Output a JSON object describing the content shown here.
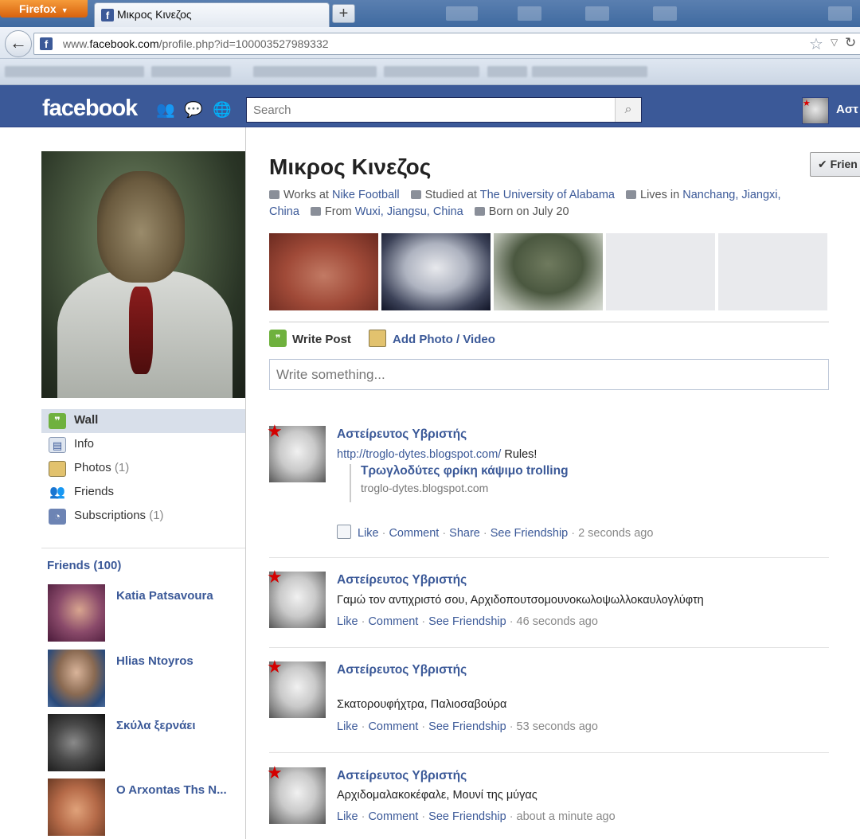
{
  "browser": {
    "app_button": "Firefox",
    "tab_title": "Μικρος Κινεζος",
    "new_tab": "+",
    "url_prefix": "www.",
    "url_domain": "facebook.com",
    "url_path": "/profile.php?id=100003527989332"
  },
  "fb": {
    "logo": "facebook",
    "search_placeholder": "Search",
    "user_short": "Αστ"
  },
  "profile": {
    "name": "Μικρος Κινεζος",
    "friend_button": "Frien",
    "works_label": "Works at",
    "works_value": "Nike Football",
    "studied_label": "Studied at",
    "studied_value": "The University of Alabama",
    "lives_label": "Lives in",
    "lives_value_1": "Nanchang, Jiangxi,",
    "lives_value_2": "China",
    "from_label": "From",
    "from_value": "Wuxi, Jiangsu, China",
    "born": "Born on July 20"
  },
  "nav": {
    "wall": "Wall",
    "info": "Info",
    "photos": "Photos",
    "photos_count": "(1)",
    "friends": "Friends",
    "subscriptions": "Subscriptions",
    "subscriptions_count": "(1)"
  },
  "friends_box": {
    "title": "Friends (100)",
    "items": [
      "Katia Patsavoura",
      "Hlias Ntoyros",
      "Σκύλα ξερνάει",
      "O Arxontas Ths N..."
    ]
  },
  "composer": {
    "write_post": "Write Post",
    "add_photo": "Add Photo / Video",
    "placeholder": "Write something..."
  },
  "posts": [
    {
      "author": "Αστείρευτος Υβριστής",
      "link": "http://troglo-dytes.blogspot.com/",
      "text": "Rules!",
      "attach_title": "Τρωγλοδύτες φρίκη κάψιμο trolling",
      "attach_domain": "troglo-dytes.blogspot.com",
      "like": "Like",
      "comment": "Comment",
      "share": "Share",
      "friendship": "See Friendship",
      "time": "2 seconds ago"
    },
    {
      "author": "Αστείρευτος Υβριστής",
      "text": "Γαμώ τον αντιχριστό σου, Αρχιδοπουτσομουνοκωλοψωλλοκαυλογλύφτη",
      "like": "Like",
      "comment": "Comment",
      "friendship": "See Friendship",
      "time": "46 seconds ago"
    },
    {
      "author": "Αστείρευτος Υβριστής",
      "text": "Σκατορουφήχτρα, Παλιοσαβούρα",
      "like": "Like",
      "comment": "Comment",
      "friendship": "See Friendship",
      "time": "53 seconds ago"
    },
    {
      "author": "Αστείρευτος Υβριστής",
      "text": "Αρχιδομαλακοκέφαλε, Μουνί της μύγας",
      "like": "Like",
      "comment": "Comment",
      "friendship": "See Friendship",
      "time": "about a minute ago"
    }
  ],
  "colors": {
    "fb_blue": "#3b5998",
    "firefox_orange": "#e8761f"
  }
}
